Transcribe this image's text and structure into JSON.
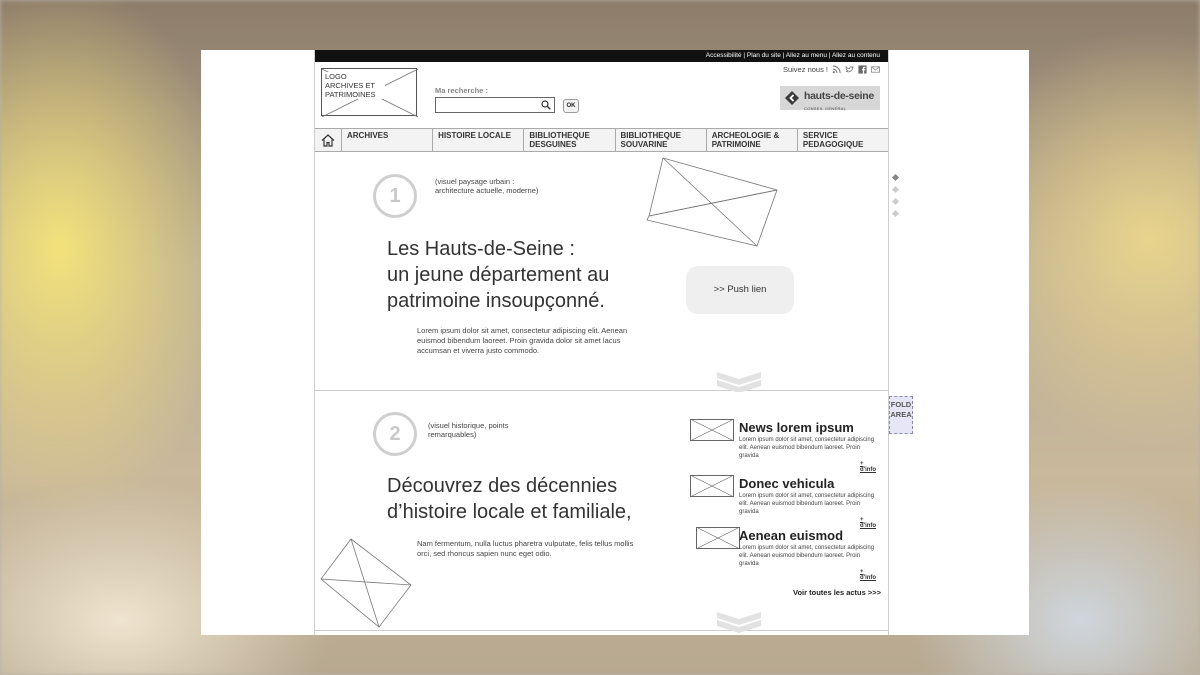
{
  "topbar": {
    "links": [
      "Accessibilité",
      "Plan du site",
      "Allez au menu",
      "Allez au contenu"
    ],
    "separator": " | "
  },
  "header": {
    "logo_text": "LOGO ARCHIVES ET PATRIMOINES",
    "search_label": "Ma recherche :",
    "search_placeholder": "",
    "search_button": "OK",
    "follow_label": "Suivez nous !",
    "social_icons": [
      "rss-icon",
      "twitter-icon",
      "facebook-icon",
      "mail-icon"
    ],
    "brand_name": "hauts-de-seine",
    "brand_sub": "CONSEIL GÉNÉRAL"
  },
  "nav": {
    "items": [
      {
        "label": "ARCHIVES"
      },
      {
        "label": "HISTOIRE LOCALE"
      },
      {
        "label": "BIBLIOTHEQUE DESGUINES"
      },
      {
        "label": "BIBLIOTHEQUE SOUVARINE"
      },
      {
        "label": "ARCHEOLOGIE & PATRIMOINE"
      },
      {
        "label": "SERVICE PEDAGOGIQUE"
      }
    ]
  },
  "section1": {
    "number": "1",
    "caption": "(visuel paysage urbain :\narchitecture actuelle, moderne)",
    "headline": "Les Hauts-de-Seine :\nun jeune département au\npatrimoine insoupçonné.",
    "body": "Lorem ipsum dolor sit amet, consectetur adipiscing elit. Aenean euismod bibendum laoreet. Proin gravida dolor sit amet lacus accumsan et viverra justo commodo.",
    "push": ">> Push lien"
  },
  "section2": {
    "number": "2",
    "caption": "(visuel historique, points\nremarquables)",
    "headline": "Découvrez des décennies\nd’histoire locale et familiale,",
    "body": "Nam fermentum, nulla luctus pharetra vulputate, felis tellus mollis orci, sed rhoncus sapien nunc eget odio.",
    "news": [
      {
        "title": "News lorem  ipsum",
        "text": "Lorem ipsum dolor sit amet, consectetur adipiscing elit. Aenean euismod bibendum laoreet. Proin gravida",
        "more": "+ d'info"
      },
      {
        "title": "Donec vehicula",
        "text": "Lorem ipsum dolor sit amet, consectetur adipiscing elit. Aenean euismod bibendum laoreet. Proin gravida",
        "more": "+ d'info"
      },
      {
        "title": "Aenean euismod",
        "text": "Lorem ipsum dolor sit amet, consectetur adipiscing elit. Aenean euismod bibendum laoreet. Proin gravida",
        "more": "+ d'info"
      }
    ],
    "see_all": "Voir toutes les actus >>>"
  },
  "fold_label": "FOLD AREA",
  "colors": {
    "nav_bg": "#f3f3f3",
    "topbar_bg": "#111111",
    "push_bg": "#efefef",
    "fold_bg": "#e6e6f6"
  }
}
